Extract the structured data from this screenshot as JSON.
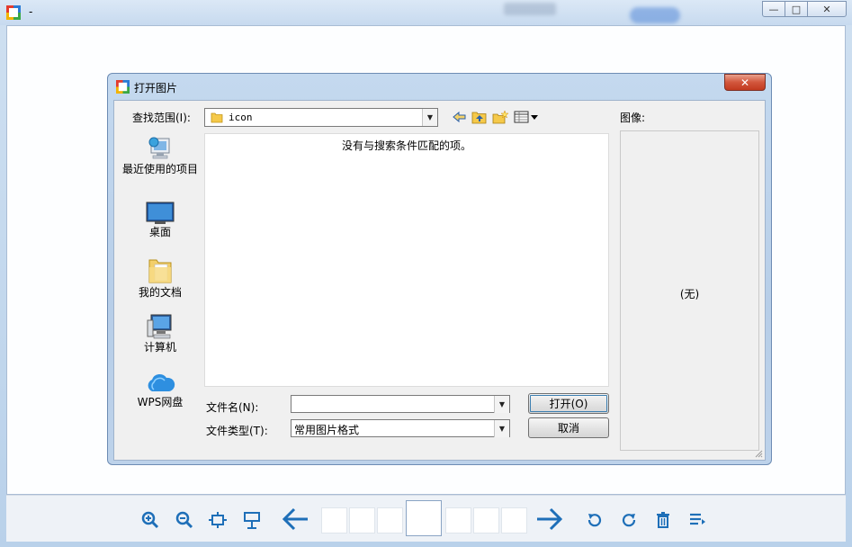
{
  "main_window": {
    "title": "-",
    "controls": {
      "minimize": "—",
      "maximize": "□",
      "close": "✕"
    }
  },
  "dialog": {
    "title": "打开图片",
    "close_label": "✕",
    "look_in": {
      "label": "查找范围(I):",
      "value": "icon"
    },
    "places": [
      {
        "label": "最近使用的项目",
        "icon": "recent-items-icon"
      },
      {
        "label": "桌面",
        "icon": "desktop-icon"
      },
      {
        "label": "我的文档",
        "icon": "documents-folder-icon"
      },
      {
        "label": "计算机",
        "icon": "computer-icon"
      },
      {
        "label": "WPS网盘",
        "icon": "cloud-drive-icon"
      }
    ],
    "empty_message": "没有与搜索条件匹配的项。",
    "file_name": {
      "label": "文件名(N):",
      "value": ""
    },
    "file_type": {
      "label": "文件类型(T):",
      "value": "常用图片格式"
    },
    "open_button": "打开(O)",
    "cancel_button": "取消",
    "preview": {
      "label": "图像:",
      "none_text": "(无)"
    }
  },
  "toolbar": {
    "icons": [
      "zoom-in-icon",
      "zoom-out-icon",
      "fit-window-icon",
      "slideshow-icon",
      "prev-arrow-icon",
      "next-arrow-icon",
      "rotate-left-icon",
      "rotate-right-icon",
      "delete-icon",
      "more-icon"
    ]
  },
  "colors": {
    "accent": "#1e6fb8",
    "dialog_frame": "#b7cee8",
    "close_red": "#c23a1f"
  }
}
